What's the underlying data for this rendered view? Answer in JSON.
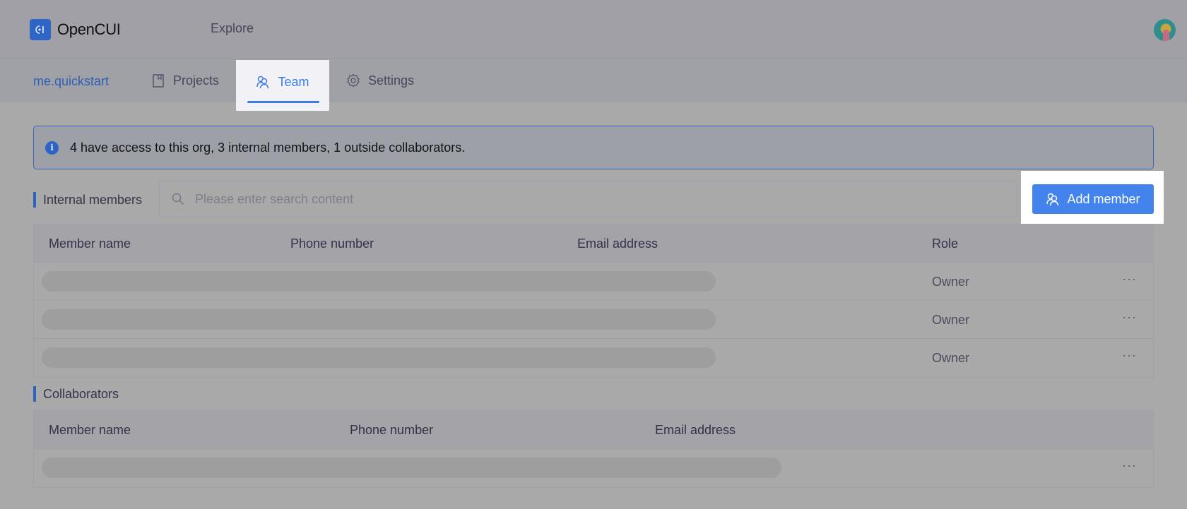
{
  "header": {
    "brand": "OpenCUI",
    "brand_icon": "opencui-logo-icon",
    "explore_label": "Explore",
    "avatar": "user-avatar"
  },
  "nav": {
    "org": "me.quickstart",
    "tabs": [
      {
        "label": "Projects",
        "icon": "book-icon",
        "active": false
      },
      {
        "label": "Team",
        "icon": "team-icon",
        "active": true
      },
      {
        "label": "Settings",
        "icon": "gear-icon",
        "active": false
      }
    ]
  },
  "alert": {
    "icon": "info-icon",
    "text": "4 have access to this org, 3 internal members, 1 outside collaborators."
  },
  "internal": {
    "title": "Internal members",
    "search_placeholder": "Please enter search content",
    "search_value": "",
    "add_button": "Add member",
    "columns": [
      "Member name",
      "Phone number",
      "Email address",
      "Role"
    ],
    "rows": [
      {
        "role": "Owner",
        "more": "···"
      },
      {
        "role": "Owner",
        "more": "···"
      },
      {
        "role": "Owner",
        "more": "···"
      }
    ]
  },
  "collaborators": {
    "title": "Collaborators",
    "columns": [
      "Member name",
      "Phone number",
      "Email address"
    ],
    "rows": [
      {
        "more": "···"
      }
    ]
  },
  "colors": {
    "accent": "#4283ec",
    "brand": "#2f66c5",
    "active_tab": "#3b7de4"
  }
}
